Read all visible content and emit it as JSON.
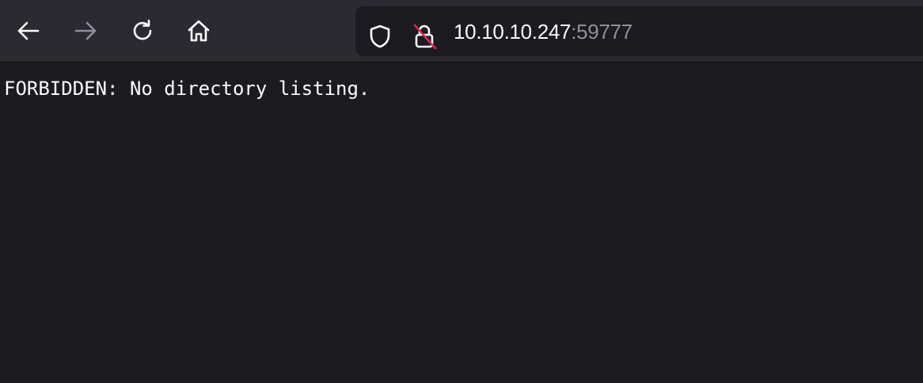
{
  "toolbar": {
    "back_icon": "arrow-left-icon",
    "forward_icon": "arrow-right-icon",
    "reload_icon": "reload-icon",
    "home_icon": "home-icon"
  },
  "urlbar": {
    "shield_icon": "shield-icon",
    "lock_icon": "insecure-lock-icon",
    "host": "10.10.10.247",
    "port": ":59777"
  },
  "page": {
    "body_text": "FORBIDDEN: No directory listing."
  },
  "colors": {
    "toolbar_bg": "#2b2a33",
    "page_bg": "#1c1b22",
    "text": "#fbfbfe",
    "muted_text": "#8f8f9d",
    "disabled_icon": "#8f8f9d",
    "insecure_strike": "#e22850"
  }
}
